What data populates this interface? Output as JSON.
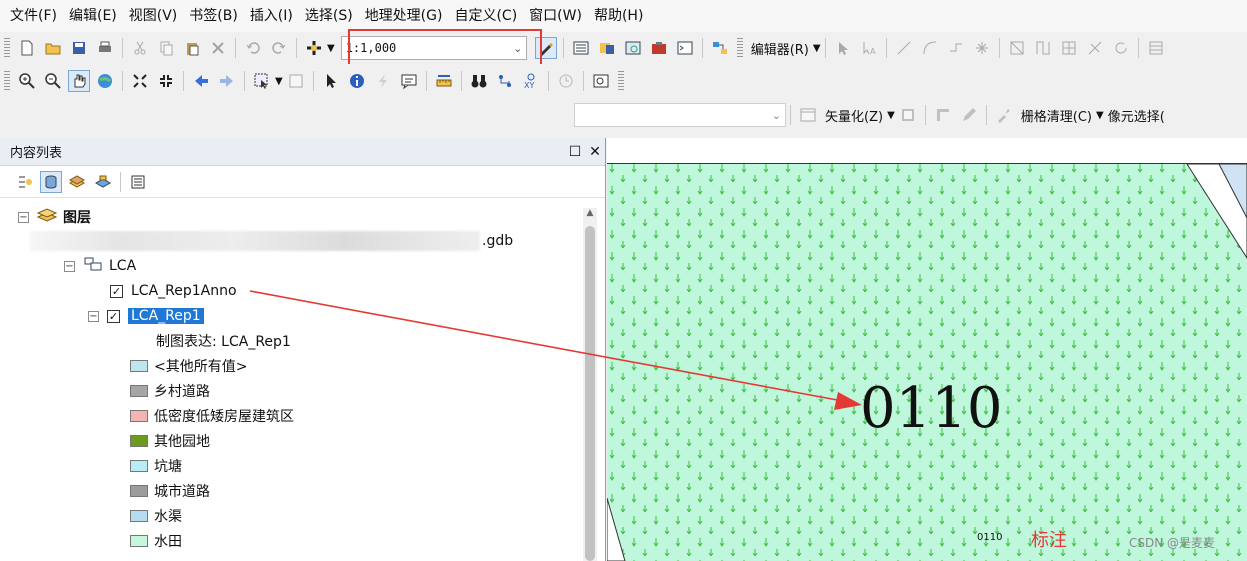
{
  "menubar": {
    "items": [
      "文件(F)",
      "编辑(E)",
      "视图(V)",
      "书签(B)",
      "插入(I)",
      "选择(S)",
      "地理处理(G)",
      "自定义(C)",
      "窗口(W)",
      "帮助(H)"
    ]
  },
  "toolbar1": {
    "scale_value": "1:1,000",
    "editor_label": "编辑器(R)"
  },
  "toolbar3": {
    "vectorize_label": "矢量化(Z)",
    "raster_cleanup_label": "栅格清理(C)",
    "pixel_select_label": "像元选择("
  },
  "toc": {
    "title": "内容列表",
    "layers_root": "图层",
    "gdb_suffix": ".gdb",
    "group_name": "LCA",
    "anno_layer": "LCA_Rep1Anno",
    "rep_layer": "LCA_Rep1",
    "representation_label": "制图表达: LCA_Rep1",
    "legend": [
      {
        "label": "<其他所有值>",
        "color": "#bfe6ee"
      },
      {
        "label": "乡村道路",
        "color": "#a6a6a6"
      },
      {
        "label": "低密度低矮房屋建筑区",
        "color": "#f5b4b4"
      },
      {
        "label": "其他园地",
        "color": "#6e9a1e"
      },
      {
        "label": "坑塘",
        "color": "#b8ecf6"
      },
      {
        "label": "城市道路",
        "color": "#9c9c9c"
      },
      {
        "label": "水渠",
        "color": "#b7dcf2"
      },
      {
        "label": "水田",
        "color": "#c4f7dc"
      }
    ]
  },
  "map": {
    "annotation_large": "0110",
    "annotation_small": "0110",
    "callout_label": "标注",
    "watermark": "CSDN @是麦麦",
    "fill_color": "#bff7dd",
    "symbol_color": "#3fbf3f",
    "arrow_color": "#e53935"
  }
}
